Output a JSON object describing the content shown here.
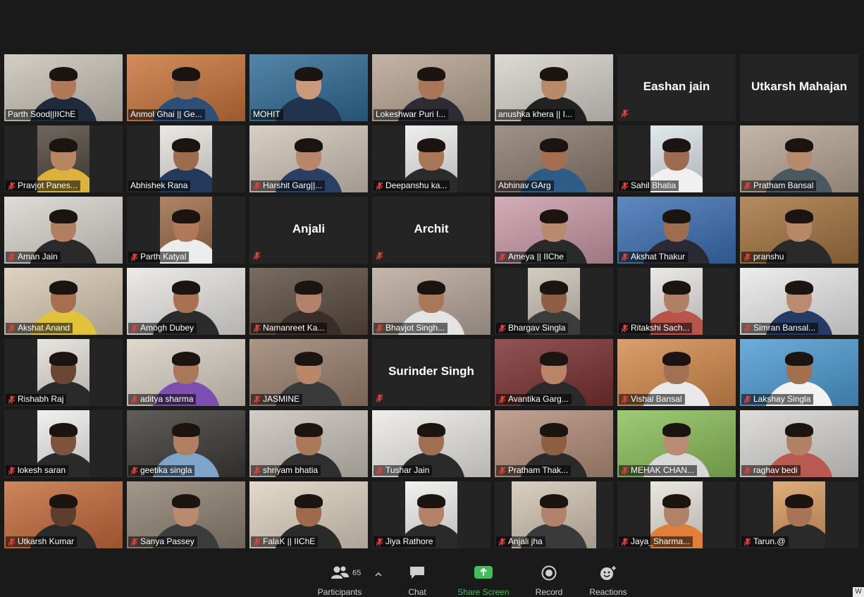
{
  "gallery": [
    {
      "name": "Parth Sood||IIChE",
      "muted": false,
      "video": true,
      "bg": "#c9c3b9",
      "skin": "#b07a58",
      "shirt": "#1f2a3a"
    },
    {
      "name": "Anmol Ghai || Ge...",
      "muted": false,
      "video": true,
      "active": true,
      "bg": "#c8743a",
      "skin": "#a4714f",
      "shirt": "#2d4f77"
    },
    {
      "name": "MOHIT",
      "muted": false,
      "video": true,
      "bg": "#2f6a95",
      "skin": "#c99a7a",
      "shirt": "#22334d"
    },
    {
      "name": "Lokeshwar Puri  I...",
      "muted": false,
      "video": true,
      "bg": "#b7a493",
      "skin": "#a97659",
      "shirt": "#2d2b33"
    },
    {
      "name": "anushka khera || I...",
      "muted": false,
      "video": true,
      "bg": "#d6d2cb",
      "skin": "#b98a6a",
      "shirt": "#222222"
    },
    {
      "name": "Eashan jain",
      "muted": true,
      "video": false
    },
    {
      "name": "Utkarsh Mahajan",
      "muted": false,
      "video": false
    },
    {
      "name": "Pravjot Panes...",
      "muted": true,
      "video": true,
      "frame": "narrow",
      "bg": "#4f463c",
      "skin": "#b88562",
      "shirt": "#d9b33b"
    },
    {
      "name": "Abhishek Rana",
      "muted": false,
      "video": true,
      "frame": "narrow",
      "bg": "#e7e4df",
      "skin": "#9d6b4d",
      "shirt": "#243a5c"
    },
    {
      "name": "Harshit Garg||...",
      "muted": true,
      "video": true,
      "bg": "#cfc5b8",
      "skin": "#b8866a",
      "shirt": "#2b3e63"
    },
    {
      "name": "Deepanshu ka...",
      "muted": true,
      "video": true,
      "frame": "narrow",
      "bg": "#ececec",
      "skin": "#a97758",
      "shirt": "#2b2b2b"
    },
    {
      "name": "Abhinav GArg",
      "muted": false,
      "video": true,
      "bg": "#8a7a6e",
      "skin": "#a46f50",
      "shirt": "#2f5c86"
    },
    {
      "name": "Sahil Bhatia",
      "muted": true,
      "video": true,
      "frame": "narrow",
      "bg": "#dbe4e9",
      "skin": "#9d6b4f",
      "shirt": "#f0f0f0"
    },
    {
      "name": "Pratham Bansal",
      "muted": true,
      "video": true,
      "bg": "#b7a595",
      "skin": "#b88a6d",
      "shirt": "#4a5860"
    },
    {
      "name": "Aman Jain",
      "muted": true,
      "video": true,
      "bg": "#d9d4ce",
      "skin": "#b07f60",
      "shirt": "#2a2a2a"
    },
    {
      "name": "Parth Katyal",
      "muted": true,
      "video": true,
      "frame": "narrow",
      "bg": "#9b6a45",
      "skin": "#b07a5a",
      "shirt": "#ececec"
    },
    {
      "name": "Anjali",
      "muted": true,
      "video": false
    },
    {
      "name": "Archit",
      "muted": true,
      "video": false
    },
    {
      "name": "Ameya || IIChe",
      "muted": true,
      "video": true,
      "bg": "#c99aa8",
      "skin": "#b98a70",
      "shirt": "#2a2a2a"
    },
    {
      "name": "Akshat Thakur",
      "muted": true,
      "video": true,
      "bg": "#3b6fb3",
      "skin": "#9e6c4e",
      "shirt": "#2a2a35"
    },
    {
      "name": "pranshu",
      "muted": true,
      "video": true,
      "bg": "#a3733e",
      "skin": "#b88866",
      "shirt": "#2a2a2a"
    },
    {
      "name": "Akshat Anand",
      "muted": true,
      "video": true,
      "bg": "#d8c9b4",
      "skin": "#a66f4f",
      "shirt": "#e0c33a"
    },
    {
      "name": "Amogh Dubey",
      "muted": true,
      "video": true,
      "bg": "#e8e6e3",
      "skin": "#a77152",
      "shirt": "#2b2b2b"
    },
    {
      "name": "Namanreet Ka...",
      "muted": true,
      "video": true,
      "bg": "#5b4b3f",
      "skin": "#b3826b",
      "shirt": "#3a2e2a"
    },
    {
      "name": "Bhavjot Singh...",
      "muted": true,
      "video": true,
      "bg": "#b8a79a",
      "skin": "#a9785a",
      "shirt": "#e4e4e4"
    },
    {
      "name": "Bhargav Singla",
      "muted": true,
      "video": true,
      "frame": "narrow",
      "bg": "#c9c1b4",
      "skin": "#8e5f45",
      "shirt": "#3c3c3c"
    },
    {
      "name": "Ritakshi Sach...",
      "muted": true,
      "video": true,
      "frame": "narrow",
      "bg": "#e6e4e1",
      "skin": "#b08066",
      "shirt": "#b8544a"
    },
    {
      "name": "Simran Bansal...",
      "muted": true,
      "video": true,
      "bg": "#e9e9ea",
      "skin": "#b98b70",
      "shirt": "#273a63"
    },
    {
      "name": "Rishabh Raj",
      "muted": true,
      "video": true,
      "frame": "narrow",
      "bg": "#e3dfd9",
      "skin": "#6c4634",
      "shirt": "#2a2a2a"
    },
    {
      "name": "aditya sharma",
      "muted": true,
      "video": true,
      "bg": "#d8d1c4",
      "skin": "#a9785a",
      "shirt": "#7c4fb0"
    },
    {
      "name": "JASMINE",
      "muted": true,
      "video": true,
      "bg": "#9a7f6c",
      "skin": "#b88769",
      "shirt": "#3a3a3a"
    },
    {
      "name": "Surinder Singh",
      "muted": true,
      "video": false
    },
    {
      "name": "Avantika Garg...",
      "muted": true,
      "video": true,
      "bg": "#7a2f2f",
      "skin": "#b98566",
      "shirt": "#2a2a2a"
    },
    {
      "name": "Vishal Bansal",
      "muted": true,
      "video": true,
      "bg": "#d48a4c",
      "skin": "#a27053",
      "shirt": "#e8e8e8"
    },
    {
      "name": "Lakshay Singla",
      "muted": true,
      "video": true,
      "bg": "#4d9bd3",
      "skin": "#a3704f",
      "shirt": "#f2f2f2"
    },
    {
      "name": "lokesh saran",
      "muted": true,
      "video": true,
      "frame": "narrow",
      "bg": "#efeeec",
      "skin": "#7d533e",
      "shirt": "#2a2a2a"
    },
    {
      "name": "geetika singla",
      "muted": true,
      "video": true,
      "bg": "#3d3a37",
      "skin": "#b27f63",
      "shirt": "#7ea4c9"
    },
    {
      "name": "shriyam bhatia",
      "muted": true,
      "video": true,
      "bg": "#c8c2b9",
      "skin": "#a9785b",
      "shirt": "#2f2f2f"
    },
    {
      "name": "Tushar Jain",
      "muted": true,
      "video": true,
      "bg": "#eceae6",
      "skin": "#a06f52",
      "shirt": "#2a2a2a"
    },
    {
      "name": "Pratham Thak...",
      "muted": true,
      "video": true,
      "bg": "#b48e7a",
      "skin": "#8e5e42",
      "shirt": "#2a2a2a"
    },
    {
      "name": "MEHAK CHAN...",
      "muted": true,
      "video": true,
      "bg": "#8abf5a",
      "skin": "#b98b72",
      "shirt": "#d8d8d8"
    },
    {
      "name": "raghav bedi",
      "muted": true,
      "video": true,
      "bg": "#d8d6d3",
      "skin": "#b08164",
      "shirt": "#b85a4f"
    },
    {
      "name": "Utkarsh Kumar",
      "muted": true,
      "video": true,
      "bg": "#c46a3a",
      "skin": "#5f3d2e",
      "shirt": "#2a2a2a"
    },
    {
      "name": "Sanya Passey",
      "muted": true,
      "video": true,
      "bg": "#8f8172",
      "skin": "#b88a6f",
      "shirt": "#3c3c3c"
    },
    {
      "name": "FalaK || IIChE",
      "muted": true,
      "video": true,
      "bg": "#ded1c0",
      "skin": "#9d6a4d",
      "shirt": "#2a2a2a"
    },
    {
      "name": "Jiya Rathore",
      "muted": true,
      "video": true,
      "frame": "narrow",
      "bg": "#f0efed",
      "skin": "#b38368",
      "shirt": "#2a2a2a"
    },
    {
      "name": "Anjali jha",
      "muted": true,
      "video": true,
      "frame": "mid",
      "bg": "#d2c4b3",
      "skin": "#b3826a",
      "shirt": "#3a3a3a"
    },
    {
      "name": "Jaya_Sharma...",
      "muted": true,
      "video": true,
      "frame": "narrow",
      "bg": "#e6e1da",
      "skin": "#b08268",
      "shirt": "#e07f3a"
    },
    {
      "name": "Tarun.@",
      "muted": true,
      "video": true,
      "frame": "narrow",
      "bg": "#d99a5e",
      "skin": "#a87456",
      "shirt": "#2a2a2a"
    }
  ],
  "toolbar": {
    "participants_label": "Participants",
    "participants_count": "65",
    "chat_label": "Chat",
    "share_label": "Share Screen",
    "record_label": "Record",
    "reactions_label": "Reactions",
    "corner_mark": "W"
  },
  "colors": {
    "background": "#1a1a1a",
    "tile_empty": "#242424",
    "active_speaker": "#c7cf4a",
    "muted_icon": "#e0403a",
    "share_green": "#3fbf58"
  }
}
